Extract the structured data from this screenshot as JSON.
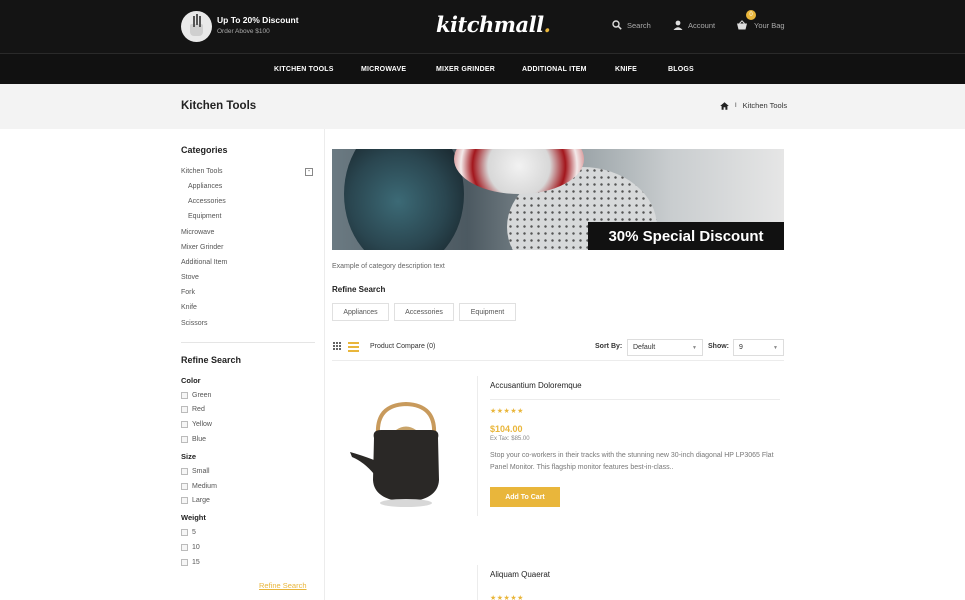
{
  "header": {
    "promo_title": "Up To 20% Discount",
    "promo_subtitle": "Order Above $100",
    "logo": "kitchmall",
    "logo_dot": ".",
    "search_label": "Search",
    "account_label": "Account",
    "bag_label": "Your Bag",
    "bag_count": "0"
  },
  "nav": [
    "KITCHEN TOOLS",
    "MICROWAVE",
    "MIXER GRINDER",
    "ADDITIONAL ITEM",
    "KNIFE",
    "BLOGS"
  ],
  "page": {
    "title": "Kitchen Tools",
    "breadcrumb_separator": "I",
    "breadcrumb_current": "Kitchen Tools"
  },
  "sidebar": {
    "categories_title": "Categories",
    "categories": [
      "Kitchen Tools",
      "Appliances",
      "Accessories",
      "Equipment",
      "Microwave",
      "Mixer Grinder",
      "Additional Item",
      "Stove",
      "Fork",
      "Knife",
      "Scissors"
    ],
    "toggle_symbol": "-",
    "refine_title": "Refine Search",
    "filters": {
      "color_title": "Color",
      "colors": [
        "Green",
        "Red",
        "Yellow",
        "Blue"
      ],
      "size_title": "Size",
      "sizes": [
        "Small",
        "Medium",
        "Large"
      ],
      "weight_title": "Weight",
      "weights": [
        "5",
        "10",
        "15"
      ]
    },
    "refine_button": "Refine Search"
  },
  "main": {
    "banner_text": "30% Special Discount",
    "category_description": "Example of category description text",
    "refine_title": "Refine Search",
    "refine_pills": [
      "Appliances",
      "Accessories",
      "Equipment"
    ],
    "compare_label": "Product Compare (0)",
    "sort_label": "Sort By:",
    "sort_value": "Default",
    "show_label": "Show:",
    "show_value": "9",
    "caret": "▼"
  },
  "products": [
    {
      "name": "Accusantium Doloremque",
      "rating": 5,
      "stars": "★★★★★",
      "price": "$104.00",
      "ex_tax": "Ex Tax: $85.00",
      "description": "Stop your co-workers in their tracks with the stunning new 30-inch diagonal HP LP3065 Flat Panel Monitor. This flagship monitor features best-in-class..",
      "add_to_cart": "Add To Cart"
    },
    {
      "name": "Aliquam Quaerat",
      "stars": "★★★★★"
    }
  ],
  "colors": {
    "accent": "#e9b63b",
    "header_bg": "#141414",
    "band_bg": "#f3f3f3"
  }
}
